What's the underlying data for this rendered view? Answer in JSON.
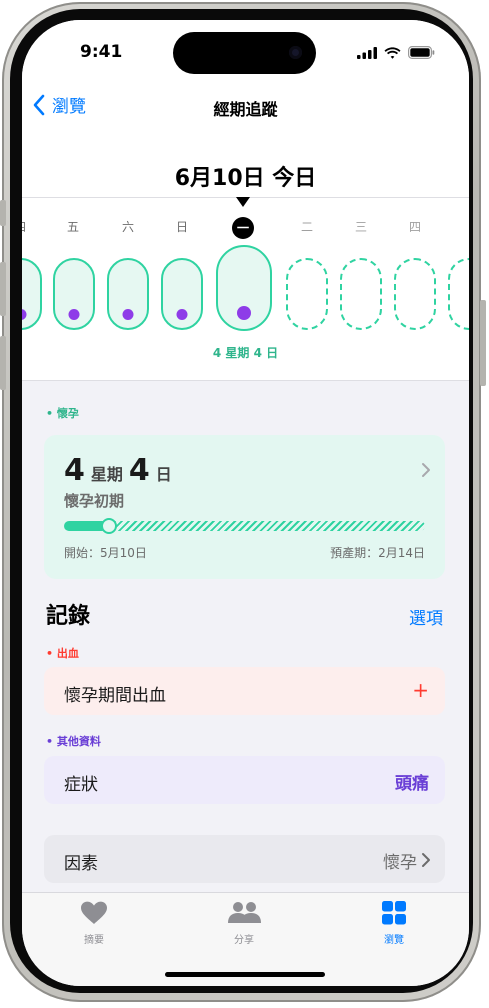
{
  "status": {
    "time": "9:41"
  },
  "nav": {
    "back_label": "瀏覽",
    "title": "經期追蹤"
  },
  "date_header": "6月10日 今日",
  "week": {
    "days": [
      {
        "label": "四",
        "future": false
      },
      {
        "label": "五",
        "future": false
      },
      {
        "label": "六",
        "future": false
      },
      {
        "label": "日",
        "future": false
      },
      {
        "label": "一",
        "future": false,
        "today": true
      },
      {
        "label": "二",
        "future": true
      },
      {
        "label": "三",
        "future": true
      },
      {
        "label": "四",
        "future": true
      }
    ],
    "caption": "4 星期 4 日"
  },
  "pregnancy": {
    "tag": "• 懷孕",
    "weeks": "4",
    "weeks_unit": "星期",
    "days": "4",
    "days_unit": "日",
    "stage": "懷孕初期",
    "progress": 0.12,
    "start": "開始：5月10日",
    "due": "預產期：2月14日"
  },
  "log": {
    "title": "記錄",
    "options": "選項",
    "bleeding_tag": "• 出血",
    "bleeding_label": "懷孕期間出血",
    "bleeding_action": "+",
    "other_tag": "• 其他資料",
    "symptoms_label": "症狀",
    "symptoms_value": "頭痛",
    "factors_label": "因素",
    "factors_value": "懷孕"
  },
  "tabs": [
    {
      "label": "摘要",
      "icon": "heart-icon"
    },
    {
      "label": "分享",
      "icon": "people-icon"
    },
    {
      "label": "瀏覽",
      "icon": "grid-icon"
    }
  ],
  "colors": {
    "accent_blue": "#007aff",
    "mint": "#2fd3a1",
    "purple": "#8e3ce8",
    "red": "#ff3b30"
  }
}
